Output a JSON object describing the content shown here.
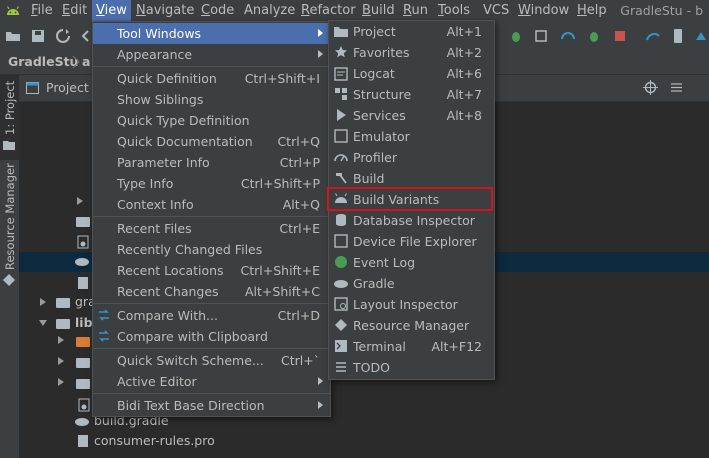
{
  "menubar": {
    "items": [
      {
        "label": "File",
        "ul": "F",
        "rest": "ile"
      },
      {
        "label": "Edit",
        "ul": "E",
        "rest": "dit"
      },
      {
        "label": "View",
        "ul": "V",
        "rest": "iew"
      },
      {
        "label": "Navigate",
        "ul": "N",
        "rest": "avigate"
      },
      {
        "label": "Code",
        "ul": "C",
        "rest": "ode"
      },
      {
        "label": "Analyze",
        "ul": "",
        "rest": "Analyze"
      },
      {
        "label": "Refactor",
        "ul": "R",
        "rest": "efactor"
      },
      {
        "label": "Build",
        "ul": "B",
        "rest": "uild"
      },
      {
        "label": "Run",
        "ul": "R",
        "rest": "un"
      },
      {
        "label": "Tools",
        "ul": "T",
        "rest": "ools"
      },
      {
        "label": "VCS",
        "ul": "",
        "rest": "VCS"
      },
      {
        "label": "Window",
        "ul": "W",
        "rest": "indow"
      },
      {
        "label": "Help",
        "ul": "H",
        "rest": "elp"
      }
    ],
    "window_title": "GradleStu - b"
  },
  "breadcrumb": {
    "project": "GradleStu",
    "child": "a"
  },
  "side_stripe": {
    "project_tab": "1: Project",
    "resource_tab": "Resource Manager"
  },
  "project_panel": {
    "title": "Project"
  },
  "tree": {
    "gra": "gra",
    "lib": "lib",
    "build_gradle": "build.gradle",
    "consumer_rules": "consumer-rules.pro"
  },
  "view_menu": {
    "items": [
      {
        "label": "Tool Windows",
        "shortcut": "",
        "submenu": true,
        "highlighted": true
      },
      {
        "label": "Appearance",
        "shortcut": "",
        "submenu": true
      },
      {
        "label": "Quick Definition",
        "shortcut": "Ctrl+Shift+I"
      },
      {
        "label": "Show Siblings",
        "shortcut": ""
      },
      {
        "label": "Quick Type Definition",
        "shortcut": ""
      },
      {
        "label": "Quick Documentation",
        "shortcut": "Ctrl+Q"
      },
      {
        "label": "Parameter Info",
        "shortcut": "Ctrl+P"
      },
      {
        "label": "Type Info",
        "shortcut": "Ctrl+Shift+P"
      },
      {
        "label": "Context Info",
        "shortcut": "Alt+Q"
      },
      {
        "label": "Recent Files",
        "shortcut": "Ctrl+E"
      },
      {
        "label": "Recently Changed Files",
        "shortcut": ""
      },
      {
        "label": "Recent Locations",
        "shortcut": "Ctrl+Shift+E"
      },
      {
        "label": "Recent Changes",
        "shortcut": "Alt+Shift+C"
      },
      {
        "label": "Compare With...",
        "shortcut": "Ctrl+D"
      },
      {
        "label": "Compare with Clipboard",
        "shortcut": ""
      },
      {
        "label": "Quick Switch Scheme...",
        "shortcut": "Ctrl+`"
      },
      {
        "label": "Active Editor",
        "shortcut": "",
        "submenu": true
      },
      {
        "label": "Bidi Text Base Direction",
        "shortcut": "",
        "submenu": true
      }
    ]
  },
  "tool_windows_menu": {
    "items": [
      {
        "label": "Project",
        "shortcut": "Alt+1",
        "icon": "folder-icon"
      },
      {
        "label": "Favorites",
        "shortcut": "Alt+2",
        "icon": "star-icon"
      },
      {
        "label": "Logcat",
        "shortcut": "Alt+6",
        "icon": "logcat-icon"
      },
      {
        "label": "Structure",
        "shortcut": "Alt+7",
        "icon": "structure-icon"
      },
      {
        "label": "Services",
        "shortcut": "Alt+8",
        "icon": "services-icon"
      },
      {
        "label": "Emulator",
        "shortcut": "",
        "icon": "emulator-icon"
      },
      {
        "label": "Profiler",
        "shortcut": "",
        "icon": "profiler-icon"
      },
      {
        "label": "Build",
        "shortcut": "",
        "icon": "hammer-icon"
      },
      {
        "label": "Build Variants",
        "shortcut": "",
        "icon": "android-icon"
      },
      {
        "label": "Database Inspector",
        "shortcut": "",
        "icon": "database-icon"
      },
      {
        "label": "Device File Explorer",
        "shortcut": "",
        "icon": "device-icon"
      },
      {
        "label": "Event Log",
        "shortcut": "",
        "icon": "event-log-icon"
      },
      {
        "label": "Gradle",
        "shortcut": "",
        "icon": "gradle-icon"
      },
      {
        "label": "Layout Inspector",
        "shortcut": "",
        "icon": "layout-inspector-icon"
      },
      {
        "label": "Resource Manager",
        "shortcut": "",
        "icon": "resource-manager-icon"
      },
      {
        "label": "Terminal",
        "shortcut": "Alt+F12",
        "icon": "terminal-icon"
      },
      {
        "label": "TODO",
        "shortcut": "",
        "icon": "todo-icon"
      }
    ]
  },
  "colors": {
    "accent": "#4b6eaf",
    "highlight_box": "#d0161b",
    "menu_bg": "#3c3f41"
  }
}
